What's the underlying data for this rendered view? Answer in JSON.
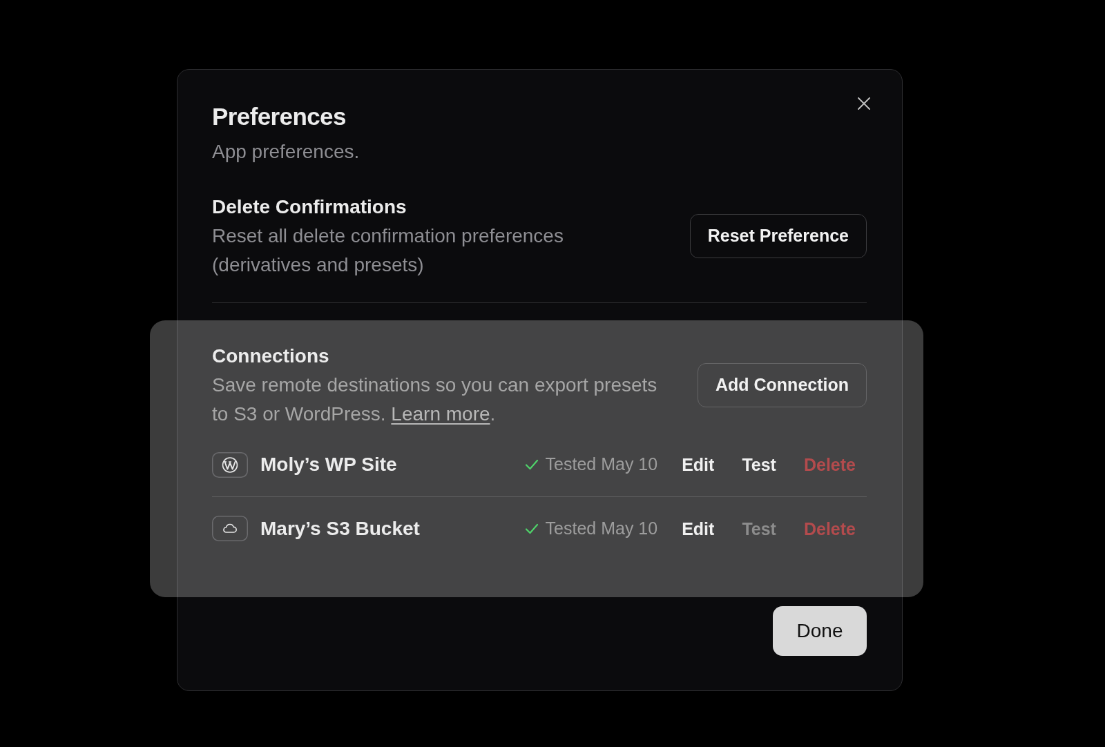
{
  "dialog": {
    "title": "Preferences",
    "subtitle": "App preferences.",
    "footer_button": "Done"
  },
  "sections": [
    {
      "kind": "setting",
      "heading": "Delete Confirmations",
      "description": "Reset all delete confirmation preferences (derivatives and presets)",
      "button": "Reset Preference",
      "highlighted": false
    },
    {
      "kind": "connections",
      "heading": "Connections",
      "description": "Save remote destinations so you can export presets to S3 or WordPress.",
      "link": "Learn more",
      "after_link": ".",
      "button": "Add Connection",
      "highlighted": true,
      "items": [
        {
          "kind": "wordpress",
          "name": "Moly’s WP Site",
          "ok": true,
          "status": "Tested May 10",
          "actions": [
            {
              "kind": "edit",
              "label": "Edit",
              "disabled": false
            },
            {
              "kind": "test",
              "label": "Test",
              "disabled": false
            },
            {
              "kind": "delete",
              "label": "Delete",
              "disabled": false
            }
          ]
        },
        {
          "kind": "s3",
          "name": "Mary’s S3 Bucket",
          "ok": true,
          "status": "Tested May 10",
          "actions": [
            {
              "kind": "edit",
              "label": "Edit",
              "disabled": false
            },
            {
              "kind": "test",
              "label": "Test",
              "disabled": true
            },
            {
              "kind": "delete",
              "label": "Delete",
              "disabled": false
            }
          ]
        }
      ]
    }
  ]
}
